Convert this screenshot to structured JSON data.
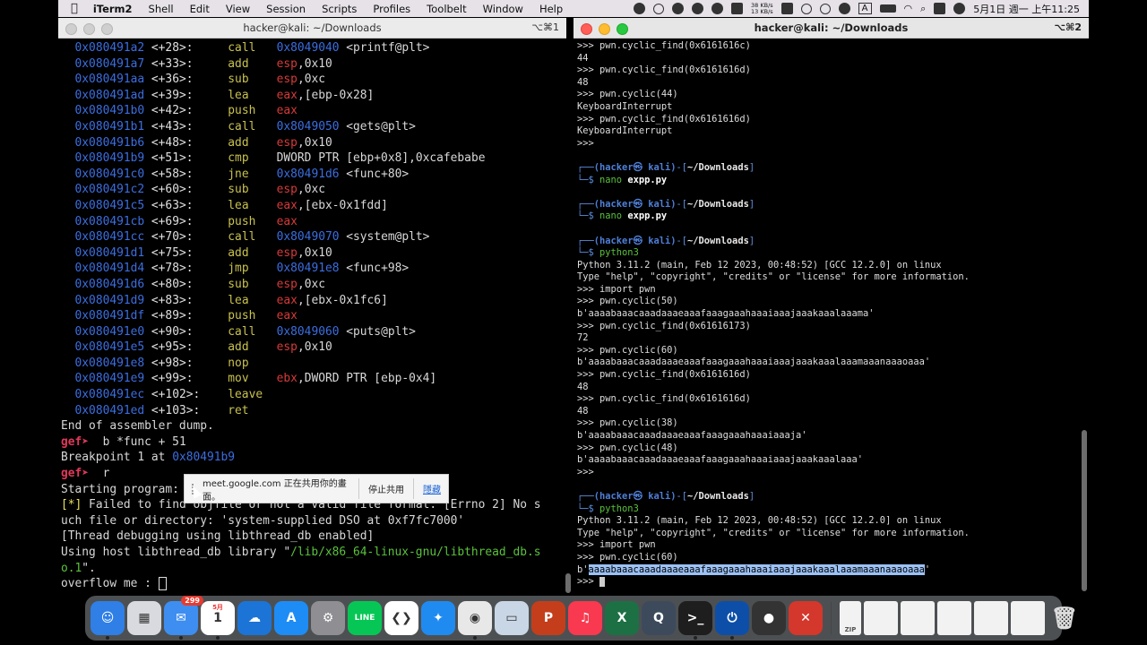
{
  "menubar": {
    "app": "iTerm2",
    "items": [
      "Shell",
      "Edit",
      "View",
      "Session",
      "Scripts",
      "Profiles",
      "Toolbelt",
      "Window",
      "Help"
    ],
    "netspeed_up": "38 KB/s",
    "netspeed_down": "13 KB/s",
    "input_method": "A",
    "clock": "5月1日 週一 上午11:25"
  },
  "left_window": {
    "title": "hacker@kali: ~/Downloads",
    "shortcut": "⌥⌘1",
    "disasm": [
      {
        "addr": "0x080491a2",
        "off": "<+28>:",
        "mn": "call",
        "a1": "0x8049040",
        "a2": " <printf@plt>"
      },
      {
        "addr": "0x080491a7",
        "off": "<+33>:",
        "mn": "add",
        "reg": "esp",
        "rest": ",0x10"
      },
      {
        "addr": "0x080491aa",
        "off": "<+36>:",
        "mn": "sub",
        "reg": "esp",
        "rest": ",0xc"
      },
      {
        "addr": "0x080491ad",
        "off": "<+39>:",
        "mn": "lea",
        "reg": "eax",
        "rest": ",[ebp-0x28]"
      },
      {
        "addr": "0x080491b0",
        "off": "<+42>:",
        "mn": "push",
        "reg": "eax",
        "rest": ""
      },
      {
        "addr": "0x080491b1",
        "off": "<+43>:",
        "mn": "call",
        "a1": "0x8049050",
        "a2": " <gets@plt>"
      },
      {
        "addr": "0x080491b6",
        "off": "<+48>:",
        "mn": "add",
        "reg": "esp",
        "rest": ",0x10"
      },
      {
        "addr": "0x080491b9",
        "off": "<+51>:",
        "mn": "cmp",
        "raw": "DWORD PTR [ebp+0x8],0xcafebabe"
      },
      {
        "addr": "0x080491c0",
        "off": "<+58>:",
        "mn": "jne",
        "a1": "0x80491d6",
        "a2": " <func+80>"
      },
      {
        "addr": "0x080491c2",
        "off": "<+60>:",
        "mn": "sub",
        "reg": "esp",
        "rest": ",0xc"
      },
      {
        "addr": "0x080491c5",
        "off": "<+63>:",
        "mn": "lea",
        "reg": "eax",
        "rest": ",[ebx-0x1fdd]"
      },
      {
        "addr": "0x080491cb",
        "off": "<+69>:",
        "mn": "push",
        "reg": "eax",
        "rest": ""
      },
      {
        "addr": "0x080491cc",
        "off": "<+70>:",
        "mn": "call",
        "a1": "0x8049070",
        "a2": " <system@plt>"
      },
      {
        "addr": "0x080491d1",
        "off": "<+75>:",
        "mn": "add",
        "reg": "esp",
        "rest": ",0x10"
      },
      {
        "addr": "0x080491d4",
        "off": "<+78>:",
        "mn": "jmp",
        "a1": "0x80491e8",
        "a2": " <func+98>"
      },
      {
        "addr": "0x080491d6",
        "off": "<+80>:",
        "mn": "sub",
        "reg": "esp",
        "rest": ",0xc"
      },
      {
        "addr": "0x080491d9",
        "off": "<+83>:",
        "mn": "lea",
        "reg": "eax",
        "rest": ",[ebx-0x1fc6]"
      },
      {
        "addr": "0x080491df",
        "off": "<+89>:",
        "mn": "push",
        "reg": "eax",
        "rest": ""
      },
      {
        "addr": "0x080491e0",
        "off": "<+90>:",
        "mn": "call",
        "a1": "0x8049060",
        "a2": " <puts@plt>"
      },
      {
        "addr": "0x080491e5",
        "off": "<+95>:",
        "mn": "add",
        "reg": "esp",
        "rest": ",0x10"
      },
      {
        "addr": "0x080491e8",
        "off": "<+98>:",
        "mn": "nop"
      },
      {
        "addr": "0x080491e9",
        "off": "<+99>:",
        "mn": "mov",
        "reg": "ebx",
        "rest": ",DWORD PTR [ebp-0x4]"
      },
      {
        "addr": "0x080491ec",
        "off": "<+102>:",
        "mn": "leave"
      },
      {
        "addr": "0x080491ed",
        "off": "<+103>:",
        "mn": "ret"
      }
    ],
    "end_dump": "End of assembler dump.",
    "prompt": "gef➤",
    "cmd1": "  b *func + 51",
    "bp_text": "Breakpoint 1 at ",
    "bp_addr": "0x80491b9",
    "cmd2": "  r",
    "starting": "Starting program: ",
    "warn_tag": "[*]",
    "warn1": " Failed to find objfile or not a valid file format: [Errno 2] No s",
    "warn2": "uch file or directory: 'system-supplied DSO at 0xf7fc7000'",
    "thread1": "[Thread debugging using libthread_db enabled]",
    "thread2_pre": "Using host libthread_db library \"",
    "thread2_path": "/lib/x86_64-linux-gnu/libthread_db.s",
    "thread3_path": "o.1",
    "thread3_post": "\".",
    "overflow": "overflow me : "
  },
  "share_bar": {
    "message": "meet.google.com 正在共用你的畫面。",
    "stop_label": "停止共用",
    "hide_label": "隱藏"
  },
  "right_window": {
    "title": "hacker@kali: ~/Downloads",
    "shortcut": "⌥⌘2",
    "kali_user": "(hacker㉿ kali)",
    "kali_path": "~/Downloads",
    "lines_top": [
      ">>> pwn.cyclic_find(0x6161616c)",
      "44",
      ">>> pwn.cyclic_find(0x6161616d)",
      "48",
      ">>> pwn.cyclic(44)",
      "KeyboardInterrupt",
      ">>> pwn.cyclic_find(0x6161616d)",
      "KeyboardInterrupt",
      ">>>"
    ],
    "cmd_nano": "nano",
    "cmd_nano_arg": "expp.py",
    "cmd_python": "python3",
    "python_banner1": "Python 3.11.2 (main, Feb 12 2023, 00:48:52) [GCC 12.2.0] on linux",
    "python_banner2": "Type \"help\", \"copyright\", \"credits\" or \"license\" for more information.",
    "session1": [
      ">>> import pwn",
      ">>> pwn.cyclic(50)",
      "b'aaaabaaacaaadaaaeaaafaaagaaahaaaiaaajaaakaaalaaama'",
      ">>> pwn.cyclic_find(0x61616173)",
      "72",
      ">>> pwn.cyclic(60)",
      "b'aaaabaaacaaadaaaeaaafaaagaaahaaaiaaajaaakaaalaaamaaanaaaoaaa'",
      ">>> pwn.cyclic_find(0x6161616d)",
      "48",
      ">>> pwn.cyclic_find(0x6161616d)",
      "48",
      ">>> pwn.cyclic(38)",
      "b'aaaabaaacaaadaaaeaaafaaagaaahaaaiaaaja'",
      ">>> pwn.cyclic(48)",
      "b'aaaabaaacaaadaaaeaaafaaagaaahaaaiaaajaaakaaalaaa'",
      ">>>"
    ],
    "session2": [
      ">>> import pwn",
      ">>> pwn.cyclic(60)"
    ],
    "sel_prefix": "b'",
    "sel_text": "aaaabaaacaaadaaaeaaafaaagaaahaaaiaaajaaakaaalaaamaaanaaaoaaa",
    "sel_suffix": "'",
    "last_prompt": ">>> "
  },
  "dock": {
    "apps": [
      {
        "name": "finder-icon",
        "color": "#2f7fe6",
        "glyph": "☺"
      },
      {
        "name": "launchpad-icon",
        "color": "#d9dadf",
        "glyph": "▦"
      },
      {
        "name": "mail-icon",
        "color": "#3d8ef0",
        "glyph": "✉",
        "badge": "299"
      },
      {
        "name": "calendar-icon",
        "color": "#ffffff",
        "glyph": "1",
        "label": "5月"
      },
      {
        "name": "onedrive-icon",
        "color": "#1c74d6",
        "glyph": "☁"
      },
      {
        "name": "app-store-icon",
        "color": "#1e8cf5",
        "glyph": "A"
      },
      {
        "name": "system-settings-icon",
        "color": "#8e8e93",
        "glyph": "⚙"
      },
      {
        "name": "line-icon",
        "color": "#06c755",
        "glyph": "LINE"
      },
      {
        "name": "vscode-icon",
        "color": "#ffffff",
        "glyph": "❮❯"
      },
      {
        "name": "safari-icon",
        "color": "#1f8bf0",
        "glyph": "✦"
      },
      {
        "name": "chrome-icon",
        "color": "#e8e8e8",
        "glyph": "◉"
      },
      {
        "name": "preview-icon",
        "color": "#c9d6e6",
        "glyph": "▭"
      },
      {
        "name": "powerpoint-icon",
        "color": "#c43e1c",
        "glyph": "P"
      },
      {
        "name": "music-icon",
        "color": "#f8394f",
        "glyph": "♫"
      },
      {
        "name": "excel-icon",
        "color": "#1d7044",
        "glyph": "X"
      },
      {
        "name": "quicktime-icon",
        "color": "#3c4a5c",
        "glyph": "Q"
      },
      {
        "name": "terminal-icon",
        "color": "#1e1e1e",
        "glyph": ">_"
      },
      {
        "name": "power-icon",
        "color": "#0d4fa8",
        "glyph": "⏻"
      },
      {
        "name": "ball-app-icon",
        "color": "#333",
        "glyph": "●"
      },
      {
        "name": "remote-desktop-icon",
        "color": "#d4372b",
        "glyph": "✕"
      }
    ],
    "recent": [
      {
        "name": "zip-file-icon",
        "label": "ZIP"
      },
      {
        "name": "document-thumb-1-icon"
      },
      {
        "name": "document-thumb-2-icon"
      },
      {
        "name": "document-thumb-3-icon"
      },
      {
        "name": "document-thumb-4-icon"
      },
      {
        "name": "document-thumb-5-icon"
      },
      {
        "name": "trash-icon"
      }
    ]
  }
}
